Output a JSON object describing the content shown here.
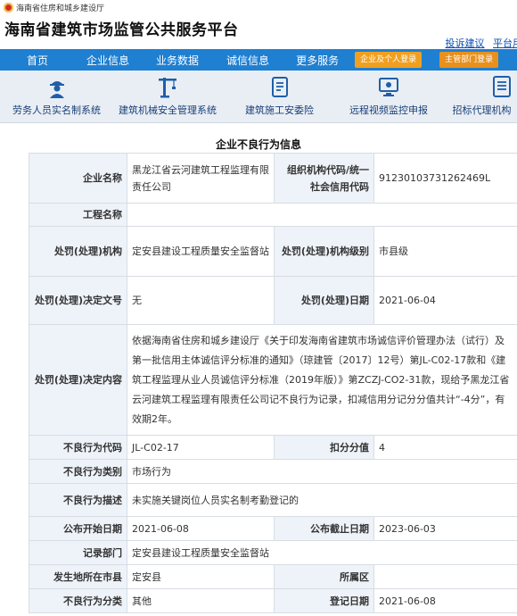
{
  "header": {
    "department": "海南省住房和城乡建设厅",
    "title": "海南省建筑市场监管公共服务平台",
    "links": [
      "投诉建议",
      "平台用"
    ]
  },
  "nav": {
    "items": [
      "首页",
      "企业信息",
      "业务数据",
      "诚信信息",
      "更多服务"
    ],
    "login_buttons": [
      "企业及个人登录",
      "主管部门登录"
    ]
  },
  "systems": [
    "劳务人员实名制系统",
    "建筑机械安全管理系统",
    "建筑施工安委险",
    "远程视频监控申报",
    "招标代理机构"
  ],
  "page_title": "企业不良行为信息",
  "record": {
    "company_name_label": "企业名称",
    "company_name": "黑龙江省云河建筑工程监理有限责任公司",
    "org_code_label": "组织机构代码/统一社会信用代码",
    "org_code": "91230103731262469L",
    "project_label": "工程名称",
    "project": "",
    "agency_label": "处罚(处理)机构",
    "agency": "定安县建设工程质量安全监督站",
    "agency_level_label": "处罚(处理)机构级别",
    "agency_level": "市县级",
    "doc_no_label": "处罚(处理)决定文号",
    "doc_no": "无",
    "date_label": "处罚(处理)日期",
    "date": "2021-06-04",
    "content_label": "处罚(处理)决定内容",
    "content": "依据海南省住房和城乡建设厅《关于印发海南省建筑市场诚信评价管理办法（试行）及第一批信用主体诚信评分标准的通知》（琼建管〔2017〕12号）第JL-C02-17款和《建筑工程监理从业人员诚信评分标准（2019年版）》第ZCZJ-CO2-31款，现给予黑龙江省云河建筑工程监理有限责任公司记不良行为记录，扣减信用分记分分值共计“-4分”，有效期2年。",
    "code_label": "不良行为代码",
    "code": "JL-C02-17",
    "score_label": "扣分分值",
    "score": "4",
    "type_label": "不良行为类别",
    "type": "市场行为",
    "desc_label": "不良行为描述",
    "desc": "未实施关键岗位人员实名制考勤登记的",
    "pub_start_label": "公布开始日期",
    "pub_start": "2021-06-08",
    "pub_end_label": "公布截止日期",
    "pub_end": "2023-06-03",
    "record_dept_label": "记录部门",
    "record_dept": "定安县建设工程质量安全监督站",
    "location_label": "发生地所在市县",
    "location": "定安县",
    "region_label": "所属区",
    "region": "",
    "category_label": "不良行为分类",
    "category": "其他",
    "reg_date_label": "登记日期",
    "reg_date": "2021-06-08"
  }
}
